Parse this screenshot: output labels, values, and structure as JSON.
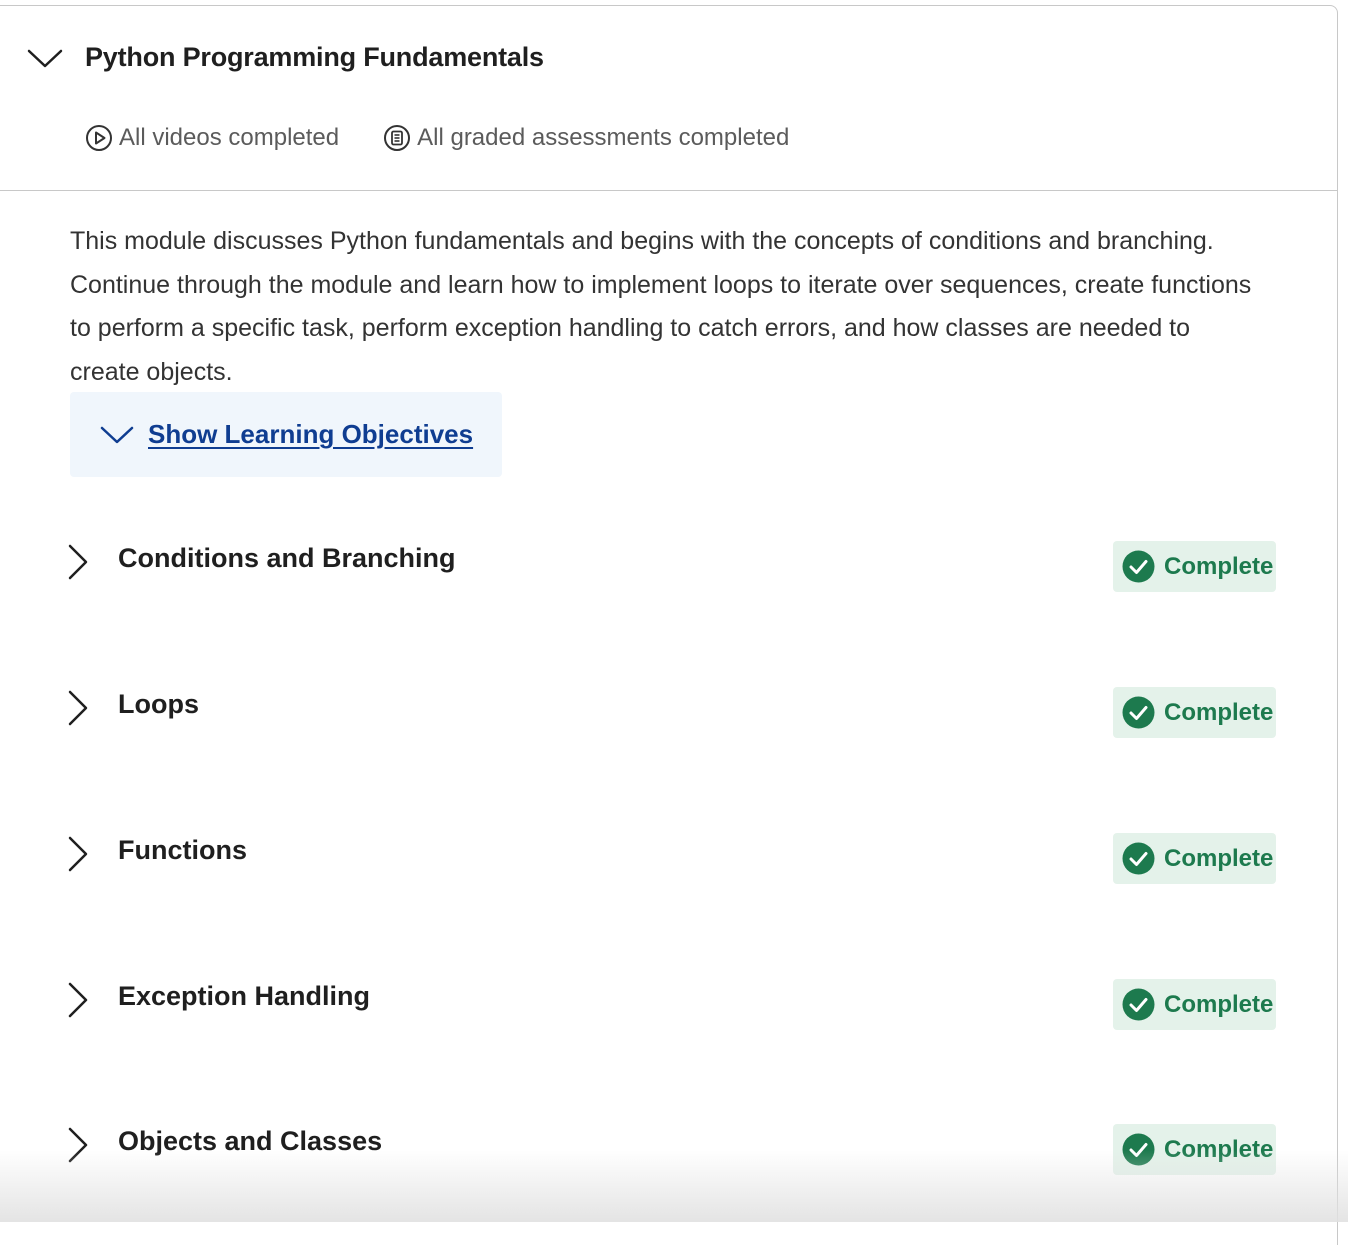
{
  "module": {
    "title": "Python Programming Fundamentals",
    "videos_status": "All videos completed",
    "assessments_status": "All graded assessments completed",
    "description": "This module discusses Python fundamentals and begins with the concepts of conditions and branching. Continue through the module and learn how to implement loops to iterate over sequences, create functions to perform a specific task, perform exception handling to catch errors, and how classes are needed to create objects.",
    "objectives_label": "Show Learning Objectives"
  },
  "lessons": [
    {
      "title": "Conditions and Branching",
      "status": "Complete"
    },
    {
      "title": "Loops",
      "status": "Complete"
    },
    {
      "title": "Functions",
      "status": "Complete"
    },
    {
      "title": "Exception Handling",
      "status": "Complete"
    },
    {
      "title": "Objects and Classes",
      "status": "Complete"
    }
  ],
  "colors": {
    "link": "#0f3d91",
    "complete_text": "#1d7a4e",
    "complete_bg": "#e4f2ea",
    "objectives_bg": "#f0f6fc"
  },
  "icons": {
    "collapse": "chevron-down-icon",
    "videos": "play-circle-icon",
    "assessments": "document-circle-icon",
    "lesson_expand": "chevron-right-icon",
    "complete": "check-circle-icon"
  }
}
